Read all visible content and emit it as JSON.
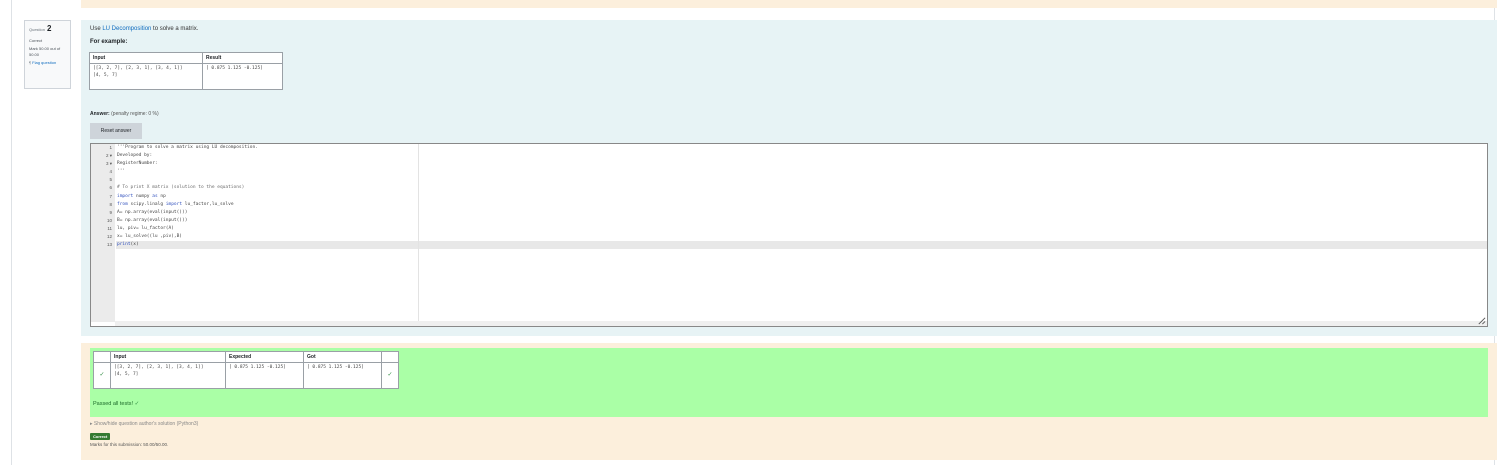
{
  "question": {
    "label": "Question",
    "number": "2",
    "state": "Correct",
    "grade": "Mark 50.00 out of 50.00",
    "flag_label": "Flag question",
    "text_prefix": "Use ",
    "text_link": "LU Decomposition",
    "text_suffix": " to solve a matrix.",
    "for_example": "For example:",
    "example_table": {
      "headers": [
        "Input",
        "Result"
      ],
      "rows": [
        {
          "input": [
            "[[3, 2, 7], [2, 3, 1], [3, 4, 1]]",
            "[4, 5, 7]"
          ],
          "result": "[ 0.875  1.125 -0.125]"
        }
      ]
    }
  },
  "answer": {
    "label": "Answer:",
    "penalty": "(penalty regime: 0 %)",
    "reset_label": "Reset answer",
    "gutter": [
      "1",
      "2 ▾",
      "3 ▾",
      "4",
      "5",
      "6",
      "7",
      "8",
      "9",
      "10",
      "11",
      "12",
      "13"
    ],
    "active_line": 12,
    "lines": [
      "'''Program to solve a matrix using LU decomposition.",
      "Developed by:",
      "RegisterNumber:",
      "'''",
      "",
      "# To print X matrix (solution to the equations)",
      "import numpy as np",
      "from scipy.linalg import lu_factor,lu_solve",
      "A= np.array(eval(input()))",
      "B= np.array(eval(input()))",
      "lu, piv= lu_factor(A)",
      "x= lu_solve((lu ,piv),B)",
      "print(x)"
    ]
  },
  "results": {
    "headers": [
      "",
      "Input",
      "Expected",
      "Got",
      ""
    ],
    "rows": [
      {
        "input": [
          "[[3, 2, 7], [2, 3, 1], [3, 4, 1]]",
          "[4, 5, 7]"
        ],
        "expected": "[ 0.875  1.125 -0.125]",
        "got": "[ 0.875  1.125 -0.125]"
      }
    ],
    "passed_text": "Passed all tests!"
  },
  "solution_link": "Show/hide question author's solution (Python3)",
  "badge": "Correct",
  "marks_text": "Marks for this submission: 50.00/50.00.",
  "colors": {
    "formulation_bg": "#e7f3f5",
    "outcome_bg": "#fcefdc",
    "feedback_bg": "#aaffa6",
    "link": "#0f6cbf",
    "correct_badge": "#357a32"
  }
}
